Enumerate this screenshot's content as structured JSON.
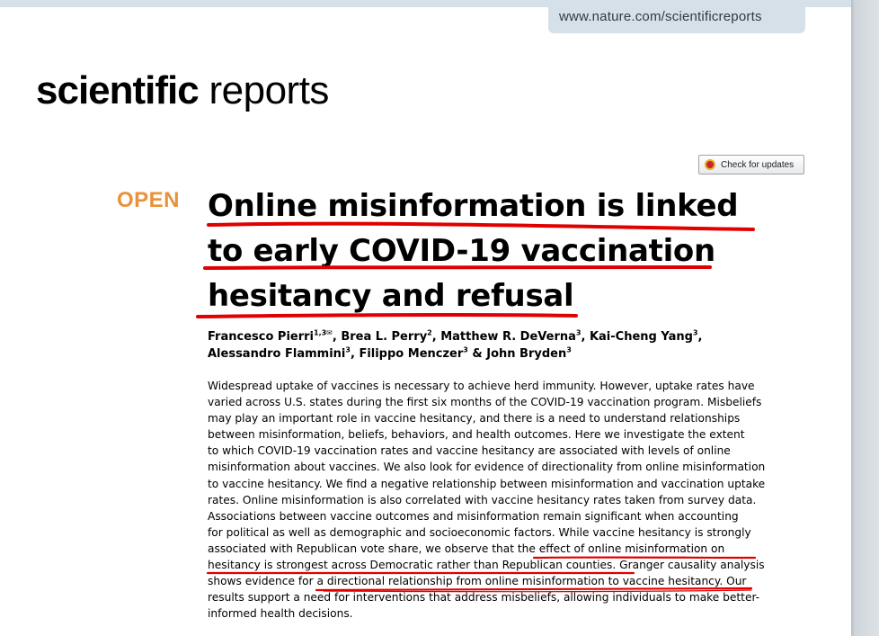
{
  "header": {
    "url": "www.nature.com/scientificreports",
    "journal_bold": "scientific",
    "journal_light": " reports",
    "check_updates": "Check for updates"
  },
  "article": {
    "access_label": "OPEN",
    "title_lines": [
      "Online misinformation is linked",
      "to early COVID-19 vaccination",
      "hesitancy and refusal"
    ],
    "authors": [
      {
        "name": "Francesco Pierri",
        "aff": "1,3",
        "mail": "✉",
        "sep": ", "
      },
      {
        "name": "Brea L. Perry",
        "aff": "2",
        "sep": ", "
      },
      {
        "name": "Matthew R. DeVerna",
        "aff": "3",
        "sep": ", "
      },
      {
        "name": "Kai-Cheng Yang",
        "aff": "3",
        "sep": ","
      },
      {
        "name": "Alessandro Flammini",
        "aff": "3",
        "sep": ", "
      },
      {
        "name": "Filippo Menczer",
        "aff": "3",
        "sep": " & "
      },
      {
        "name": "John Bryden",
        "aff": "3",
        "sep": ""
      }
    ],
    "abstract_lines": [
      "Widespread uptake of vaccines is necessary to achieve herd immunity. However, uptake rates have",
      "varied across U.S. states during the first six months of the COVID-19 vaccination program. Misbeliefs",
      "may play an important role in vaccine hesitancy, and there is a need to understand relationships",
      "between misinformation, beliefs, behaviors, and health outcomes. Here we investigate the extent",
      "to which COVID-19 vaccination rates and vaccine hesitancy are associated with levels of online",
      "misinformation about vaccines. We also look for evidence of directionality from online misinformation",
      "to vaccine hesitancy. We find a negative relationship between misinformation and vaccination uptake",
      "rates. Online misinformation is also correlated with vaccine hesitancy rates taken from survey data.",
      "Associations between vaccine outcomes and misinformation remain significant when accounting",
      "for political as well as demographic and socioeconomic factors. While vaccine hesitancy is strongly",
      "associated with Republican vote share, we observe that the effect of online misinformation on",
      "hesitancy is strongest across Democratic rather than Republican counties. Granger causality analysis",
      "shows evidence for a directional relationship from online misinformation to vaccine hesitancy. Our",
      "results support a need for interventions that address misbeliefs, allowing individuals to make better-",
      "informed health decisions."
    ]
  },
  "colors": {
    "open_label": "#e8923a",
    "annotation_ink": "#e00000",
    "url_tab": "#d6e0e8"
  }
}
